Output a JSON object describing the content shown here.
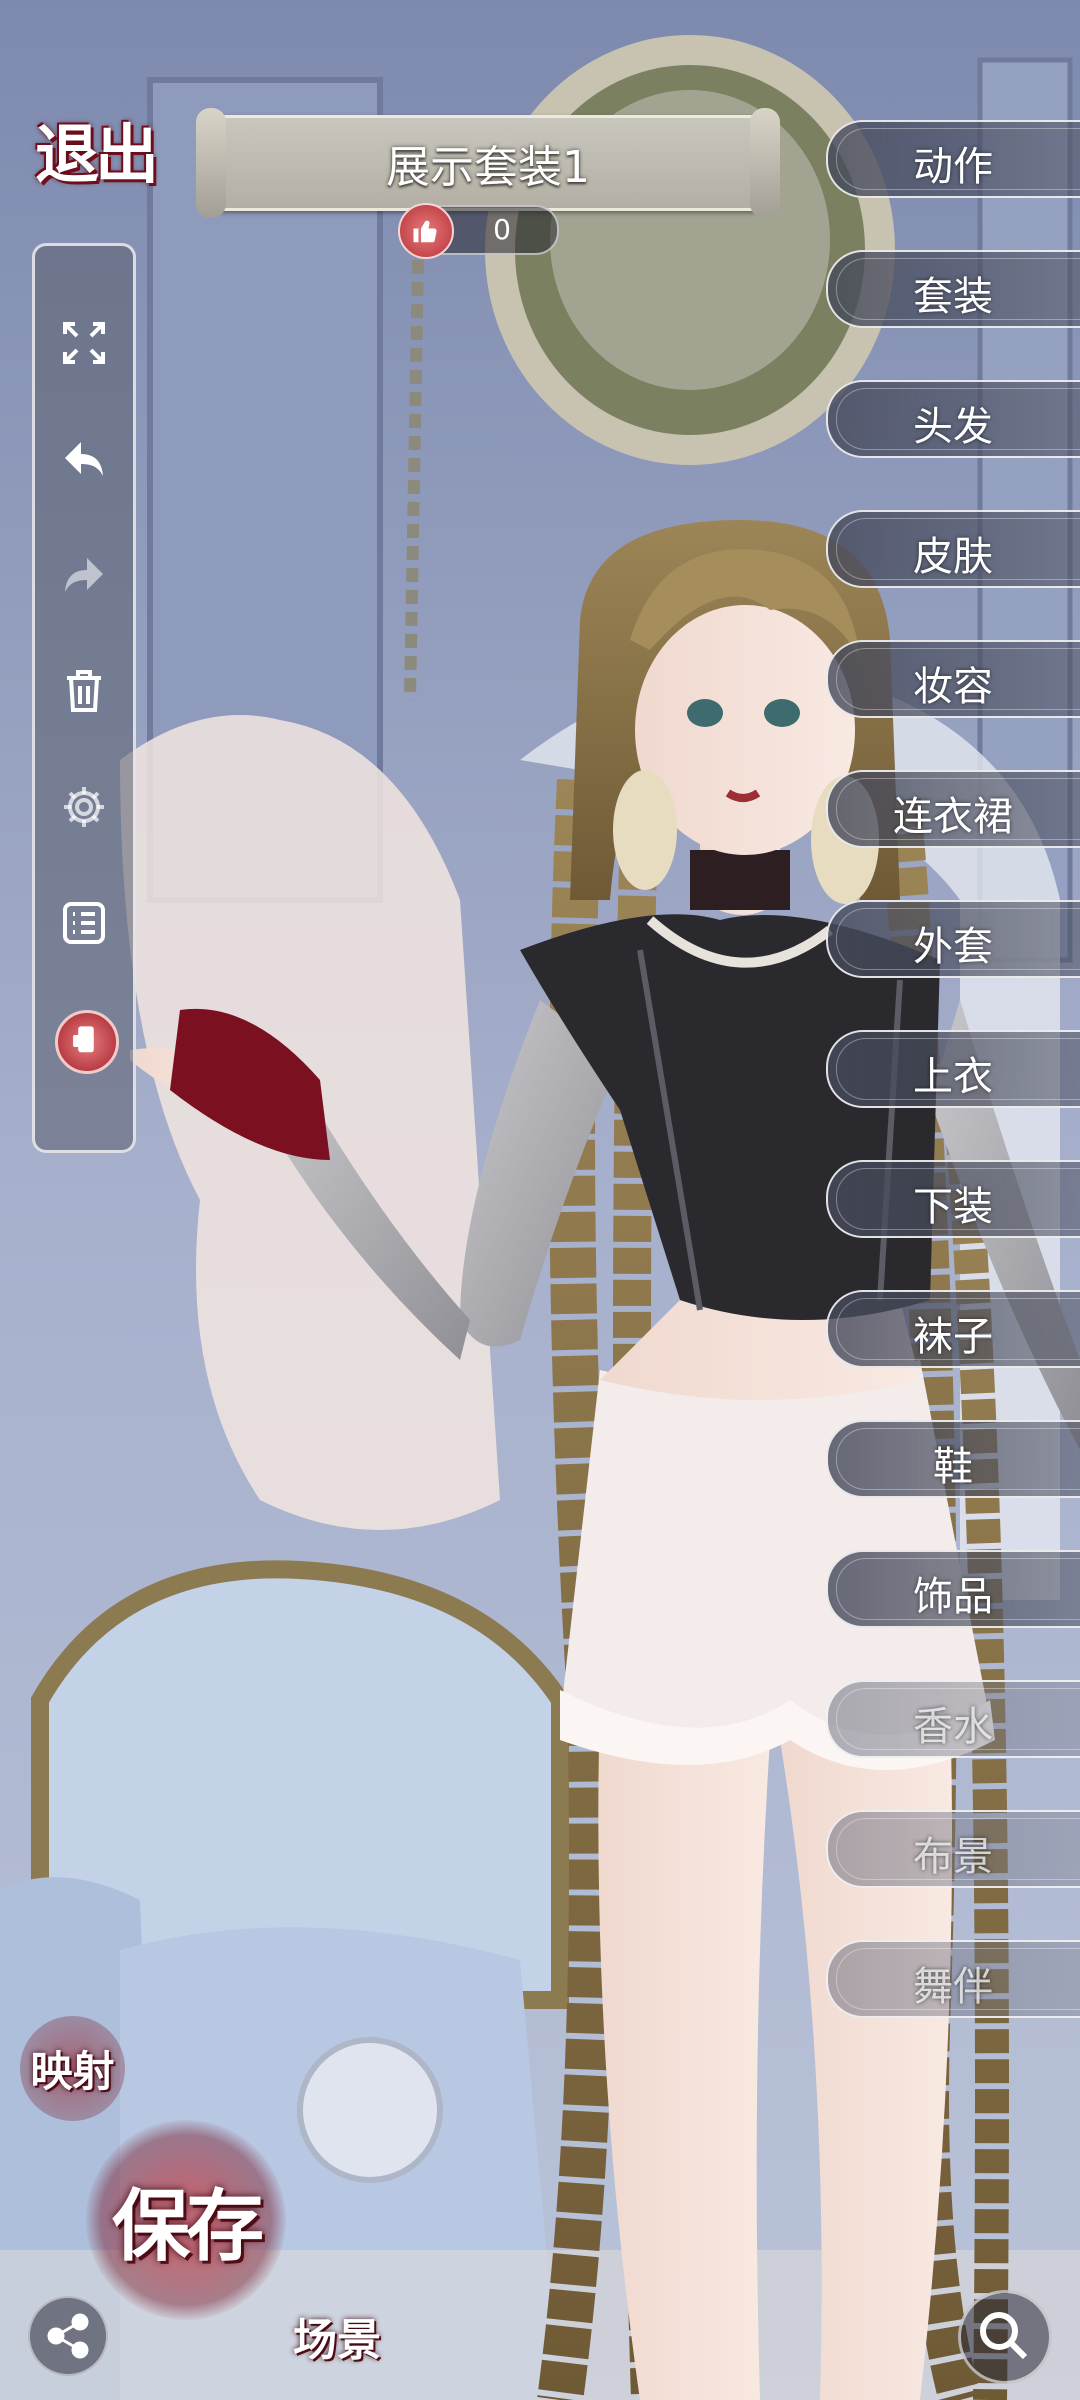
{
  "header": {
    "exit_label": "退出",
    "outfit_title": "展示套装1",
    "like_count": "0"
  },
  "toolbar": {
    "items": [
      "fullscreen-icon",
      "undo-icon",
      "redo-icon",
      "trash-icon",
      "settings-icon",
      "list-icon",
      "phone-icon"
    ]
  },
  "menu": {
    "items": [
      {
        "label": "动作"
      },
      {
        "label": "套装"
      },
      {
        "label": "头发"
      },
      {
        "label": "皮肤"
      },
      {
        "label": "妆容"
      },
      {
        "label": "连衣裙"
      },
      {
        "label": "外套"
      },
      {
        "label": "上衣"
      },
      {
        "label": "下装"
      },
      {
        "label": "袜子"
      },
      {
        "label": "鞋"
      },
      {
        "label": "饰品"
      },
      {
        "label": "香水"
      },
      {
        "label": "布景"
      },
      {
        "label": "舞伴"
      }
    ]
  },
  "bottom": {
    "map_label": "映射",
    "save_label": "保存",
    "scene_label": "场景"
  },
  "colors": {
    "accent": "#a5202c",
    "panel": "#5a5f6e",
    "menu_border": "#f5f5f5"
  }
}
